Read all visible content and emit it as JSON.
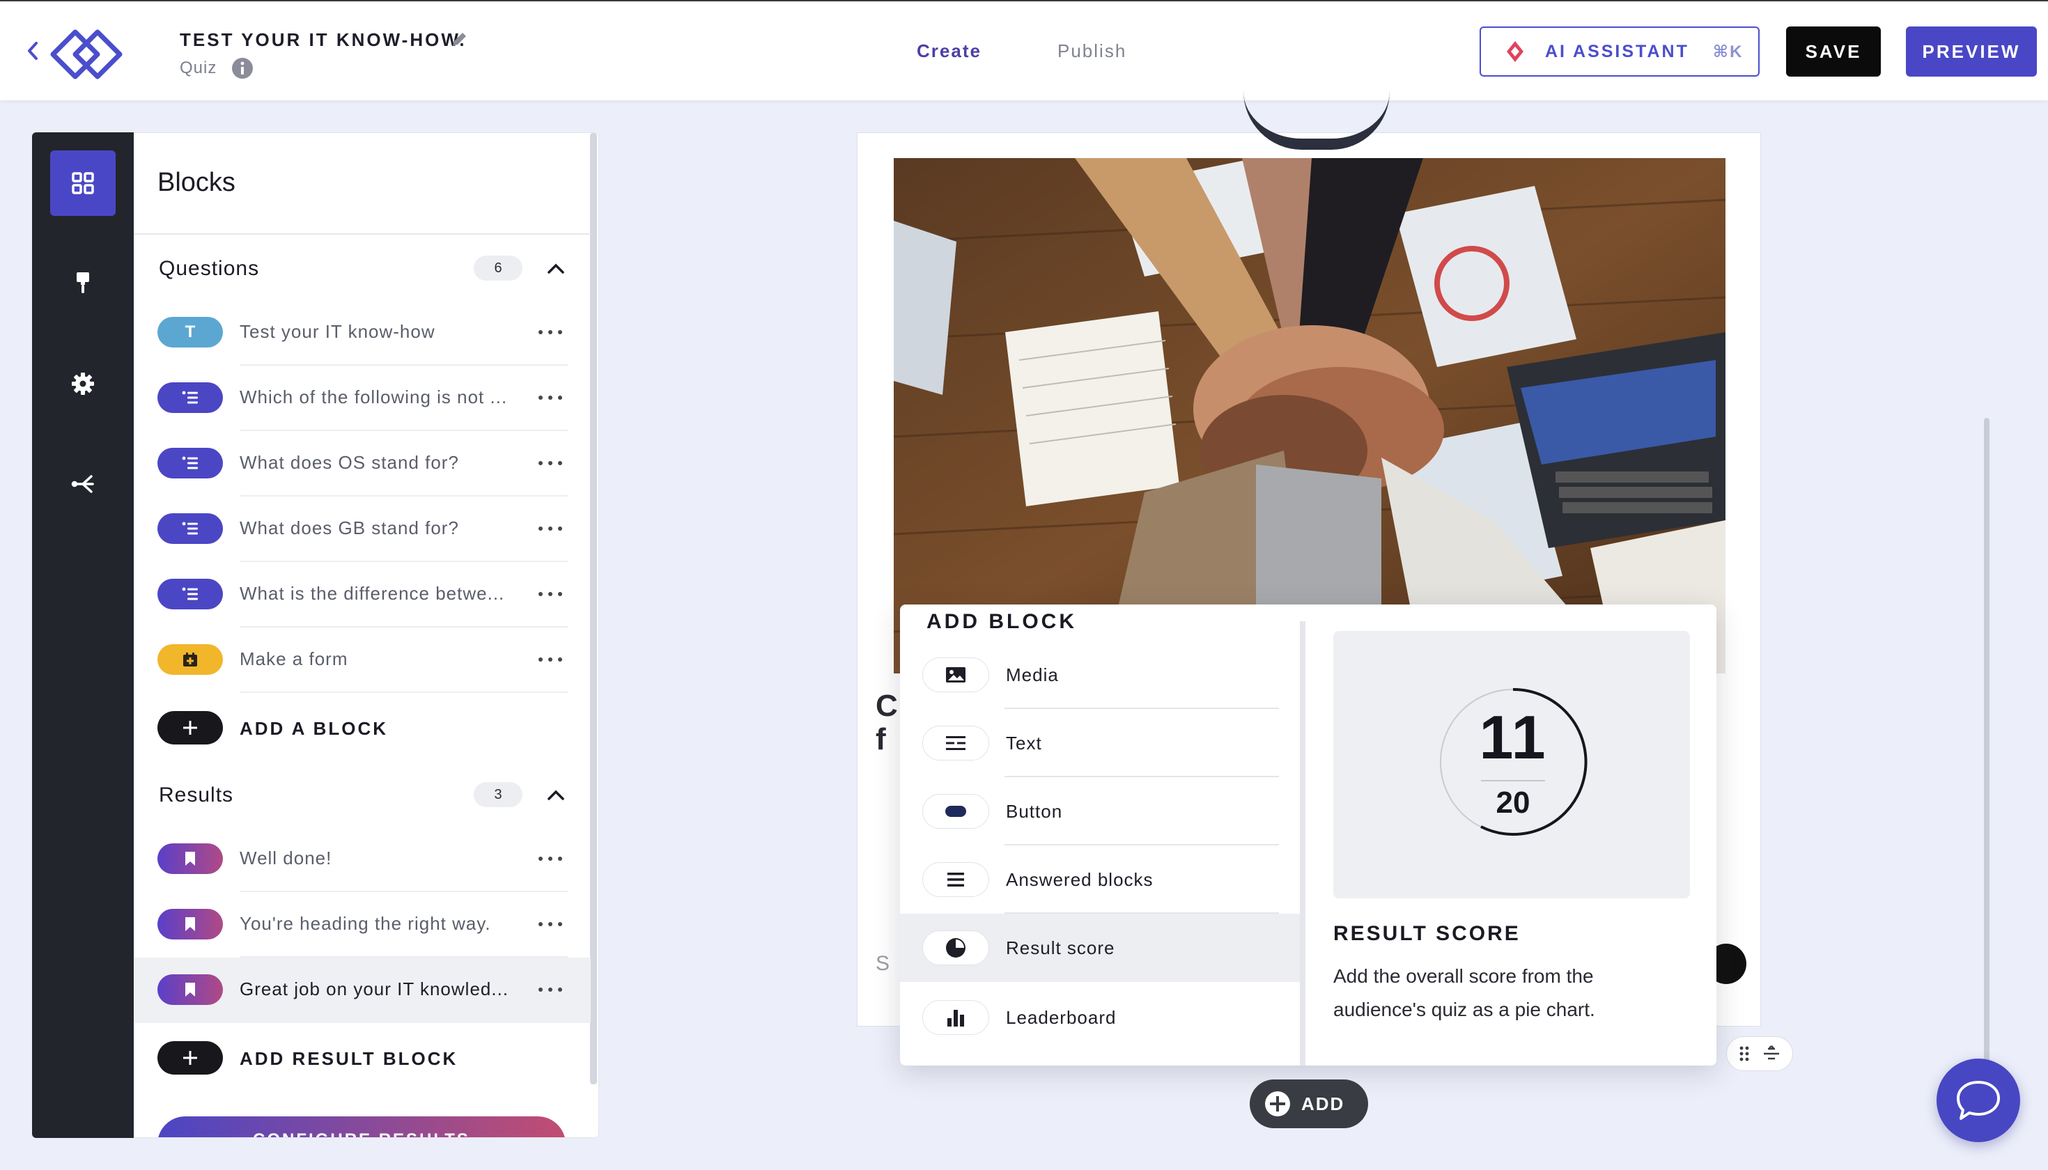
{
  "header": {
    "quiz_title": "TEST YOUR IT KNOW-HOW.",
    "quiz_type": "Quiz",
    "tabs": [
      {
        "label": "Create",
        "active": true
      },
      {
        "label": "Publish",
        "active": false
      }
    ],
    "ai_assistant_label": "AI ASSISTANT",
    "ai_assistant_shortcut": "⌘K",
    "save_label": "SAVE",
    "preview_label": "PREVIEW"
  },
  "rail": {
    "items": [
      {
        "icon": "blocks-grid-icon",
        "active": true
      },
      {
        "icon": "paint-brush-icon",
        "active": false
      },
      {
        "icon": "gear-icon",
        "active": false
      },
      {
        "icon": "share-icon",
        "active": false
      }
    ]
  },
  "panel": {
    "title": "Blocks",
    "questions": {
      "label": "Questions",
      "count": "6",
      "items": [
        {
          "type": "T",
          "label": "Test your IT know-how"
        },
        {
          "type": "list",
          "label": "Which of the following is not ..."
        },
        {
          "type": "list",
          "label": "What does OS stand for?"
        },
        {
          "type": "list",
          "label": "What does GB stand for?"
        },
        {
          "type": "list",
          "label": "What is the difference betwe..."
        },
        {
          "type": "form",
          "label": "Make a form"
        }
      ],
      "add_label": "ADD A BLOCK"
    },
    "results": {
      "label": "Results",
      "count": "3",
      "items": [
        {
          "label": "Well done!"
        },
        {
          "label": "You're heading the right way."
        },
        {
          "label": "Great job on your IT knowled..."
        }
      ],
      "add_label": "ADD RESULT BLOCK"
    },
    "configure_label": "CONFIGURE RESULTS"
  },
  "popover": {
    "title": "ADD BLOCK",
    "options": [
      {
        "label": "Media",
        "icon": "image-icon"
      },
      {
        "label": "Text",
        "icon": "text-lines-icon"
      },
      {
        "label": "Button",
        "icon": "button-pill-icon"
      },
      {
        "label": "Answered blocks",
        "icon": "list-icon"
      },
      {
        "label": "Result score",
        "icon": "pie-chart-icon",
        "highlighted": true
      },
      {
        "label": "Leaderboard",
        "icon": "bar-chart-icon"
      }
    ],
    "preview": {
      "score_value": "11",
      "score_total": "20",
      "title": "RESULT SCORE",
      "description": "Add the overall score from the audience's quiz as a pie chart."
    }
  },
  "canvas": {
    "partial_text": [
      "C",
      "f",
      "S"
    ]
  },
  "add_button_label": "ADD",
  "colors": {
    "accent": "#4a47c6",
    "rail": "#23252c",
    "save": "#0b0b0b"
  }
}
